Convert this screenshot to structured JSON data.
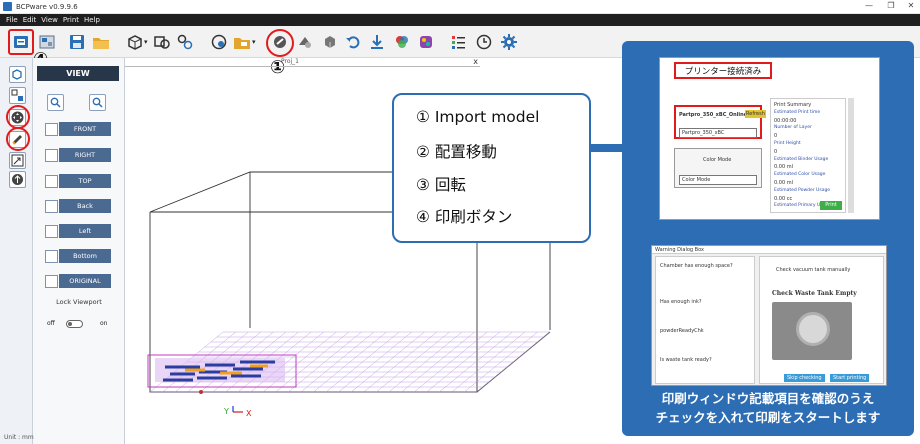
{
  "window": {
    "title": "BCPware v0.9.9.6",
    "controls": [
      "—",
      "❐",
      "✕"
    ]
  },
  "menu": [
    "File",
    "Edit",
    "View",
    "Print",
    "Help"
  ],
  "annotations": {
    "n1": "①",
    "n2": "②",
    "n3": "③",
    "n4": "④"
  },
  "view_panel": {
    "header": "VIEW",
    "buttons": [
      "FRONT",
      "RIGHT",
      "TOP",
      "Back",
      "Left",
      "Bottom",
      "ORIGINAL"
    ],
    "lock_label": "Lock Viewport",
    "off_label": "off",
    "on_label": "on"
  },
  "viewport": {
    "tab_label": "Proj_1",
    "close": "x"
  },
  "status": {
    "unit": "Unit : mm"
  },
  "callout": {
    "items": [
      "① Import model",
      "② 配置移動",
      "③ 回転",
      "④ 印刷ボタン"
    ]
  },
  "printer_dialog": {
    "connected": "プリンター接続済み",
    "printer_name": "Partpro_350_xBC_Online",
    "refresh": "Refresh",
    "select_value": "Partpro_350_xBC",
    "color_mode_title": "Color Mode",
    "color_mode_value": "Color Mode",
    "info_rows": [
      "Print Summary",
      "Estimated Print time",
      "00:00:00",
      "Number of Layer",
      "0",
      "Print Height",
      "0",
      "Estimated Binder Usage",
      "0.00 ml",
      "Estimated Color Usage",
      "0.00 ml",
      "Estimated Powder Usage",
      "0.00 cc",
      "Estimated Primary Usage"
    ],
    "print_button": "Print"
  },
  "checklist_dialog": {
    "title": "Warning Dialog Box",
    "items": [
      "Chamber has enough space?",
      "Has enough ink?",
      "powderReadyChk",
      "Is waste tank ready?"
    ],
    "check_label": "Check vacuum tank manually",
    "heading": "Check Waste Tank Empty",
    "skip_button": "Skip checking",
    "start_button": "Start printing"
  },
  "caption": {
    "line1": "印刷ウィンドウ記載項目を確認のうえ",
    "line2": "チェックを入れて印刷をスタートします"
  },
  "colors": {
    "accent_blue": "#2c6db4",
    "highlight_red": "#e11b1b",
    "panel_dark": "#28364a"
  }
}
